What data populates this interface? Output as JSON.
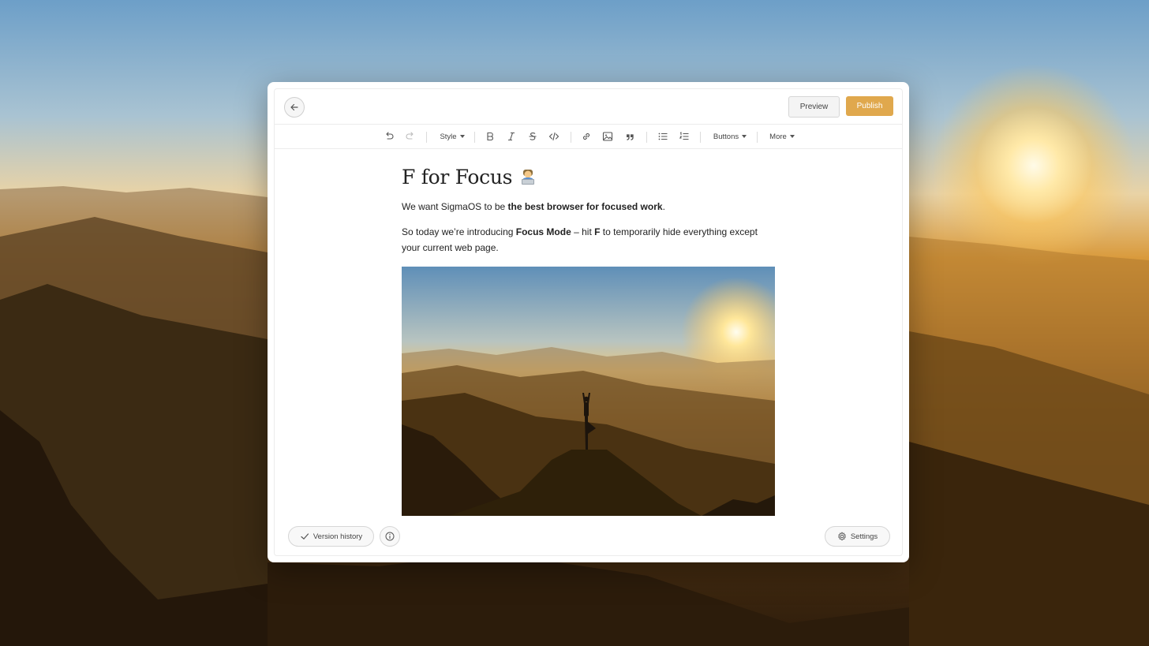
{
  "header": {
    "back_icon": "arrow-left-icon",
    "preview_label": "Preview",
    "publish_label": "Publish"
  },
  "toolbar": {
    "style_label": "Style",
    "buttons_label": "Buttons",
    "more_label": "More",
    "icons": [
      "undo-icon",
      "redo-icon",
      "bold-icon",
      "italic-icon",
      "strikethrough-icon",
      "code-icon",
      "link-icon",
      "image-icon",
      "quote-icon",
      "bullet-list-icon",
      "numbered-list-icon"
    ]
  },
  "document": {
    "title": "F for Focus",
    "title_emoji": "technologist-emoji",
    "p1_prefix": "We want SigmaOS to be ",
    "p1_bold": "the best browser for focused work",
    "p1_suffix": ".",
    "p2_prefix": "So today we’re introducing ",
    "p2_bold1": "Focus Mode",
    "p2_mid": " – hit ",
    "p2_bold2": "F",
    "p2_suffix": " to temporarily hide everything except your current web page.",
    "image_alt": "Person doing a yoga tree pose on a mountain peak at sunset"
  },
  "footer": {
    "version_label": "Version history",
    "settings_label": "Settings"
  },
  "colors": {
    "publish": "#e0a84d",
    "text": "#222222",
    "border": "#ececec"
  }
}
